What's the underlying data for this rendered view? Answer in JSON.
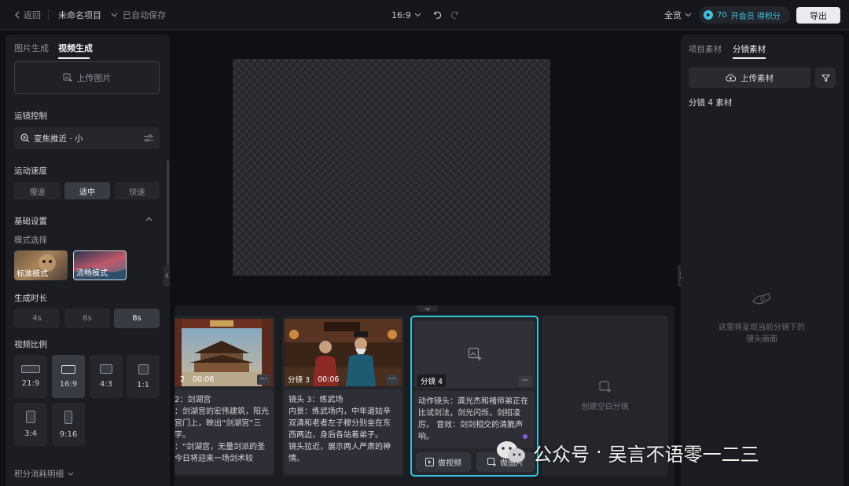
{
  "topbar": {
    "back": "返回",
    "project_name": "未命名项目",
    "autosave": "已自动保存",
    "aspect": "16:9",
    "zoom_view": "全览",
    "credits": "70",
    "credits_promo": "开会员 得积分",
    "export": "导出"
  },
  "left": {
    "tabs": [
      "图片生成",
      "视频生成"
    ],
    "active_tab": 1,
    "upload_image": "上传图片",
    "camera_control_label": "运镜控制",
    "camera_control_value": "变焦推近 · 小",
    "motion_speed_label": "运动速度",
    "motion_speeds": [
      "慢速",
      "适中",
      "快速"
    ],
    "motion_speed_selected": "适中",
    "basic_settings_label": "基础设置",
    "mode_label": "模式选择",
    "modes": [
      "标准模式",
      "流畅模式"
    ],
    "mode_selected": "流畅模式",
    "duration_label": "生成时长",
    "durations": [
      "4s",
      "6s",
      "8s"
    ],
    "duration_selected": "8s",
    "ratio_label": "视频比例",
    "ratios": [
      "21:9",
      "16:9",
      "4:3",
      "1:1",
      "3:4",
      "9:16"
    ],
    "ratio_selected": "16:9",
    "credits_detail": "积分消耗明细"
  },
  "timeline": {
    "shots": [
      {
        "label": "2",
        "time": "00:06",
        "desc": "2：剑湖宫\n：剑湖宫的宏伟建筑，阳光宫门上，映出“剑湖宫”三字。\n：“剑湖宫，无量剑派的圣今日将迎来一场剑术较"
      },
      {
        "label": "分镜 3",
        "time": "00:06",
        "desc": "镜头 3：练武场\n内景：练武场内，中年道姑辛双清和老者左子穆分别坐在东西两边，身后各站着弟子。\n镜头拉近，展示两人严肃的神情。"
      },
      {
        "label": "分镜 4",
        "desc": "动作镜头：龚光杰和褚师弟正在比试剑法，剑光闪烁，剑招凌厉。\n音效：剑剑相交的清脆声响。",
        "make_video": "做视频",
        "make_image": "做图片"
      }
    ],
    "create_blank": "创建空白分镜"
  },
  "right": {
    "tabs": [
      "项目素材",
      "分镜素材"
    ],
    "active_tab": 1,
    "upload": "上传素材",
    "section_title": "分镜 4 素材",
    "empty_hint": "这里将呈现当前分镜下的镜头画面"
  },
  "watermark": {
    "platform": "公众号",
    "separator": "·",
    "account": "吴言不语零一二三"
  },
  "colors": {
    "accent_cyan": "#2fc3da",
    "background": "#0f1014",
    "panel": "#1c1d22",
    "export_button": "#e9ebef"
  }
}
